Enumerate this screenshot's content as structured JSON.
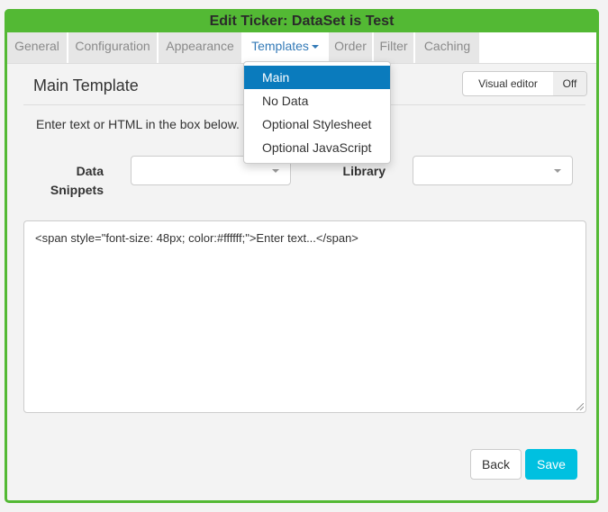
{
  "dialog": {
    "title": "Edit Ticker: DataSet is Test",
    "accent_color": "#53b934"
  },
  "tabs": [
    {
      "label": "General",
      "active": false
    },
    {
      "label": "Configuration",
      "active": false
    },
    {
      "label": "Appearance",
      "active": false
    },
    {
      "label": "Templates",
      "active": true,
      "has_dropdown": true
    },
    {
      "label": "Order",
      "active": false
    },
    {
      "label": "Filter",
      "active": false
    },
    {
      "label": "Caching",
      "active": false
    }
  ],
  "templates_menu": {
    "items": [
      {
        "label": "Main",
        "selected": true
      },
      {
        "label": "No Data",
        "selected": false
      },
      {
        "label": "Optional Stylesheet",
        "selected": false
      },
      {
        "label": "Optional JavaScript",
        "selected": false
      }
    ],
    "selected_color": "#0a7bbd"
  },
  "panel": {
    "title": "Main Template",
    "visual_editor": {
      "label": "Visual editor",
      "state": "Off"
    },
    "help_text": "Enter text or HTML in the box below.",
    "data_snippets": {
      "label_line1": "Data",
      "label_line2": "Snippets",
      "value": ""
    },
    "library": {
      "label": "Library",
      "value": ""
    },
    "editor_content": "<span style=\"font-size: 48px; color:#ffffff;\">Enter text...</span>"
  },
  "footer": {
    "back_label": "Back",
    "save_label": "Save",
    "save_color": "#00c0e0"
  }
}
